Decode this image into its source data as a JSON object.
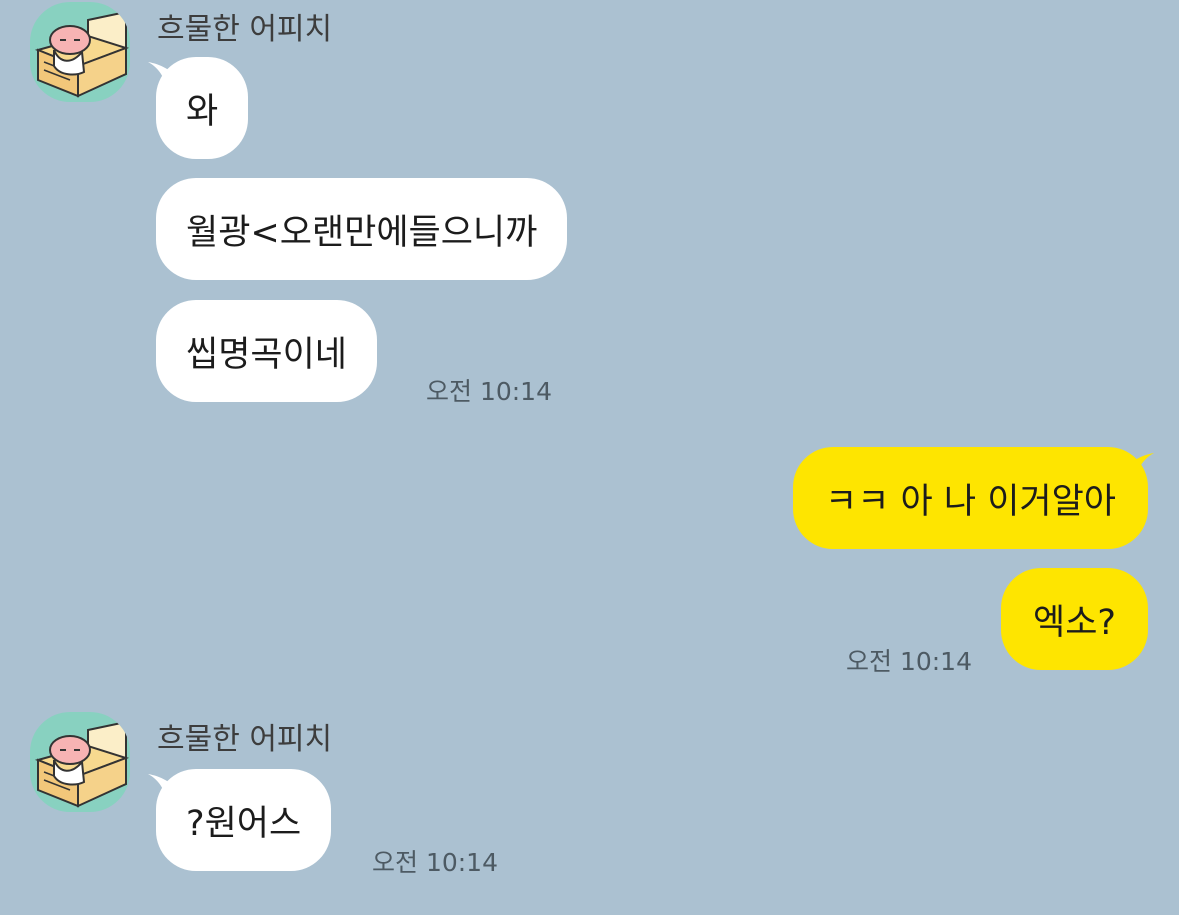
{
  "colors": {
    "background": "#abc1d1",
    "incoming_bubble": "#ffffff",
    "outgoing_bubble": "#fee500",
    "avatar_bg": "#88d1c0"
  },
  "groups": [
    {
      "sender": "흐물한 어피치",
      "avatar_icon": "apeach-on-sofa-icon",
      "messages": [
        "와",
        "월광<오랜만에들으니까",
        "씹명곡이네"
      ],
      "time": "오전 10:14"
    },
    {
      "sender": "me",
      "messages": [
        "ㅋㅋ 아 나 이거알아",
        "엑소?"
      ],
      "time": "오전 10:14"
    },
    {
      "sender": "흐물한 어피치",
      "avatar_icon": "apeach-on-sofa-icon",
      "messages": [
        "?원어스"
      ],
      "time": "오전 10:14"
    }
  ]
}
